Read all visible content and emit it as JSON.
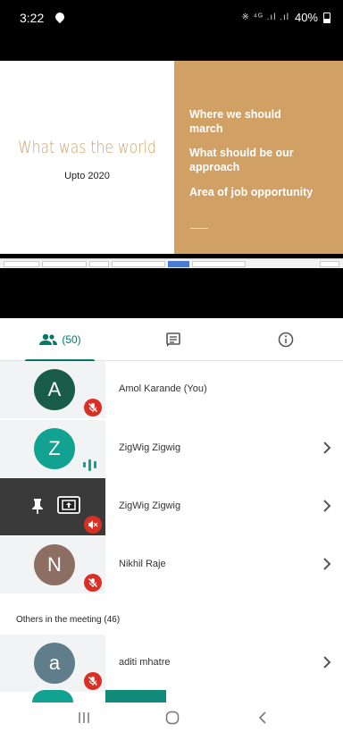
{
  "status_bar": {
    "time": "3:22",
    "signal_text": "※ ⁴ᴳ .ıl .ıl",
    "battery": "40%"
  },
  "slide": {
    "title": "What was the world",
    "subtitle": "Upto 2020",
    "bullets": [
      "Where we should march",
      "What should be our approach",
      "Area of job opportunity"
    ]
  },
  "taskbar": {
    "items": [
      "",
      "",
      "",
      "",
      "",
      "",
      ""
    ]
  },
  "tabs": {
    "people_count": "(50)"
  },
  "participants": [
    {
      "initial": "A",
      "name": "Amol Karande (You)",
      "avatar_color": "#1a5c4a",
      "status": "muted"
    },
    {
      "initial": "Z",
      "name": "ZigWig Zigwig",
      "avatar_color": "#12a292",
      "status": "speaking"
    },
    {
      "initial": "",
      "name": "ZigWig Zigwig",
      "avatar_color": "#3a3a3a",
      "status": "presenting"
    },
    {
      "initial": "N",
      "name": "Nikhil Raje",
      "avatar_color": "#8d6e63",
      "status": "muted"
    }
  ],
  "others_label": "Others in the meeting (46)",
  "others": [
    {
      "initial": "a",
      "name": "aditi mhatre",
      "avatar_color": "#607d8b",
      "status": "muted"
    }
  ],
  "colors": {
    "accent": "#00796b",
    "mic_off": "#d93025",
    "slide_panel": "#d1a065"
  }
}
